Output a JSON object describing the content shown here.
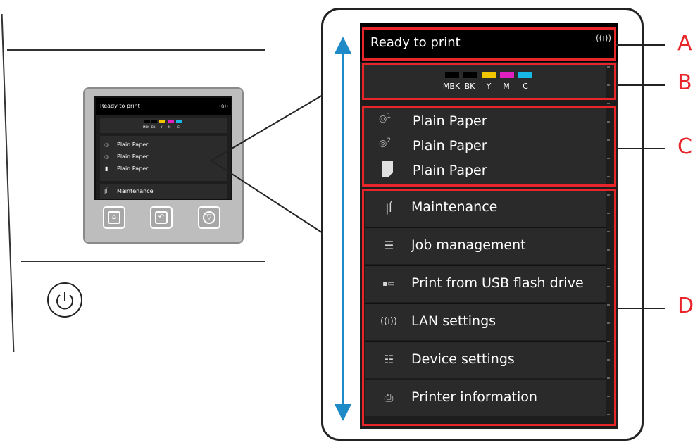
{
  "printer": {
    "mini_screen": {
      "title": "Ready to print",
      "paper_rows": [
        "Plain Paper",
        "Plain Paper",
        "Plain Paper"
      ],
      "maintenance": "Maintenance",
      "ink_labels": [
        "MBK",
        "BK",
        "Y",
        "M",
        "C"
      ]
    },
    "buttons": [
      "home-icon",
      "back-icon",
      "stop-icon"
    ],
    "power": "power-icon"
  },
  "screen": {
    "status": "Ready to print",
    "ink": [
      {
        "label": "MBK",
        "color": "#000000"
      },
      {
        "label": "BK",
        "color": "#000000"
      },
      {
        "label": "Y",
        "color": "#f2c400"
      },
      {
        "label": "M",
        "color": "#e21fbf"
      },
      {
        "label": "C",
        "color": "#17b7e6"
      }
    ],
    "paper": [
      {
        "icon": "roll-1-icon",
        "label": "Plain Paper",
        "index": "1"
      },
      {
        "icon": "roll-2-icon",
        "label": "Plain Paper",
        "index": "2"
      },
      {
        "icon": "cut-sheet-icon",
        "label": "Plain Paper"
      }
    ],
    "menu": [
      {
        "icon": "tools-icon",
        "label": "Maintenance"
      },
      {
        "icon": "job-list-icon",
        "label": "Job management"
      },
      {
        "icon": "usb-icon",
        "label": "Print from USB flash drive"
      },
      {
        "icon": "wireless-icon",
        "label": "LAN settings"
      },
      {
        "icon": "settings-icon",
        "label": "Device settings"
      },
      {
        "icon": "printer-info-icon",
        "label": "Printer information"
      }
    ]
  },
  "callouts": {
    "a": "A",
    "b": "B",
    "c": "C",
    "d": "D"
  },
  "colors": {
    "callout_red": "#e8252a",
    "scroll_arrow_blue": "#1f8ac8"
  }
}
